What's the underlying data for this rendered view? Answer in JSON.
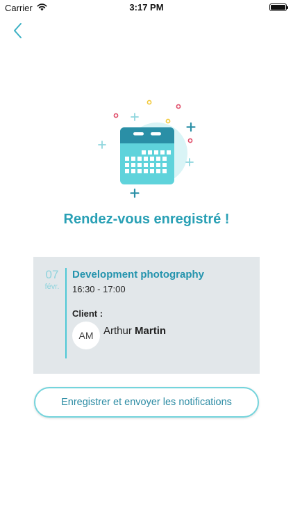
{
  "status_bar": {
    "carrier": "Carrier",
    "time": "3:17 PM"
  },
  "nav": {
    "back_icon": "chevron-left-icon"
  },
  "confirmation": {
    "title": "Rendez-vous enregistré !",
    "illustration_icon": "calendar-icon"
  },
  "appointment": {
    "day": "07",
    "month": "févr.",
    "title": "Development photography",
    "time": "16:30 - 17:00",
    "client_label": "Client :",
    "client_initials": "AM",
    "client_first_name": "Arthur",
    "client_last_name": "Martin"
  },
  "actions": {
    "notify_label": "Enregistrer et envoyer les notifications"
  },
  "colors": {
    "accent": "#29a0b5",
    "button_border": "#74d4dc",
    "card_bg": "#e2e7ea",
    "calendar_teal": "#5fd3db"
  }
}
